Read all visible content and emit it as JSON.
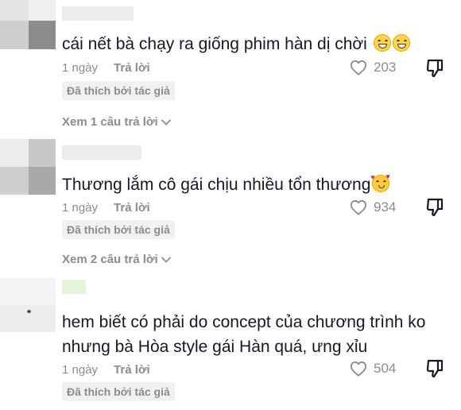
{
  "comments": [
    {
      "text": "cái nết bà chạy ra giống phim hàn dị chời",
      "emoji": [
        "grinning-squinting-face-emoji",
        "grinning-squinting-face-emoji"
      ],
      "time": "1 ngày",
      "reply_label": "Trả lời",
      "likes": "203",
      "badge": "Đã thích bởi tác giả",
      "view_replies": "Xem 1 câu trả lời"
    },
    {
      "text": "Thương lắm cô gái chịu nhiều tổn thương",
      "emoji": [
        "smiling-face-with-hearts-emoji"
      ],
      "time": "1 ngày",
      "reply_label": "Trả lời",
      "likes": "934",
      "badge": "Đã thích bởi tác giả",
      "view_replies": "Xem 2 câu trả lời"
    },
    {
      "text_line1": "hem biết có phải do concept của chương trình ko",
      "text_line2": "nhưng bà Hòa style gái Hàn quá, ưng xỉu",
      "time": "1 ngày",
      "reply_label": "Trả lời",
      "likes": "504",
      "badge": "Đã thích bởi tác giả"
    }
  ],
  "colors": {
    "text": "#161823",
    "muted": "#8a8b91",
    "badge_bg": "#f1f1f2"
  },
  "icons": {
    "like": "heart-outline-icon",
    "dislike": "thumbs-down-icon",
    "expand": "chevron-down-icon"
  }
}
